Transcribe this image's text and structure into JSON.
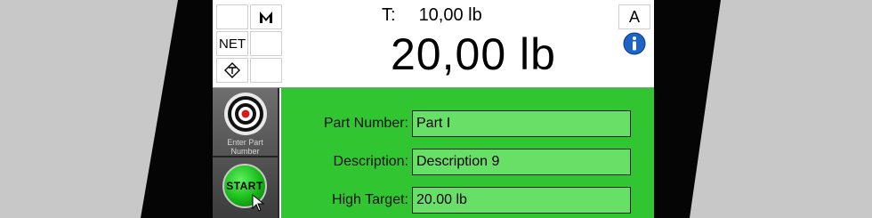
{
  "header": {
    "net_label": "NET",
    "tare_label": "T:",
    "tare_value": "10,00 lb",
    "weight_value": "20,00 lb",
    "mode_label": "A",
    "icons": [
      "scale-stable-icon",
      "center-of-zero-icon",
      "info-icon"
    ]
  },
  "left_panel": {
    "enter_part_label": "Enter Part Number",
    "start_label": "START"
  },
  "form": {
    "fields": [
      {
        "label": "Part Number:",
        "value": "Part I"
      },
      {
        "label": "Description:",
        "value": "Description 9"
      },
      {
        "label": "High Target:",
        "value": "20.00 lb"
      }
    ]
  },
  "colors": {
    "form_background": "#31c631",
    "field_background": "#68e068",
    "start_button": "#18b818"
  }
}
